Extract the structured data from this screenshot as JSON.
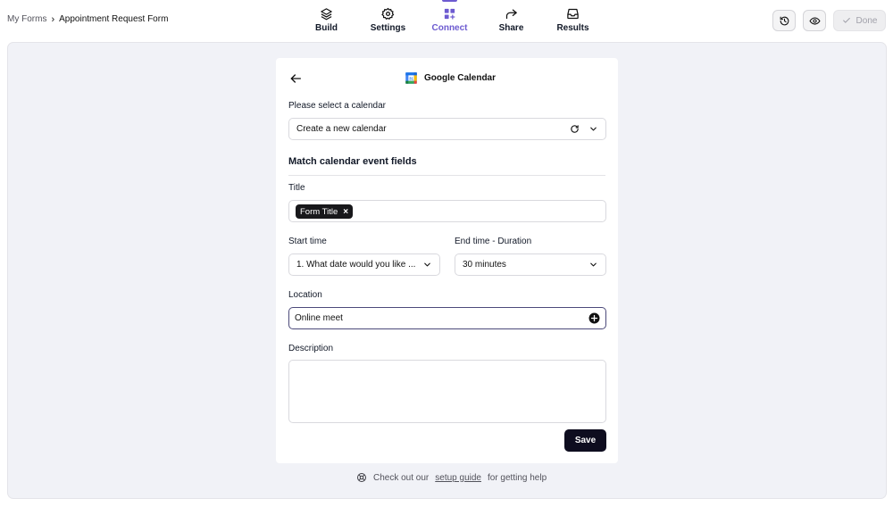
{
  "breadcrumb": {
    "parent": "My Forms",
    "separator": "›",
    "current": "Appointment Request Form"
  },
  "nav_tabs": [
    {
      "label": "Build",
      "icon": "layers-icon",
      "active": false
    },
    {
      "label": "Settings",
      "icon": "gear-icon",
      "active": false
    },
    {
      "label": "Connect",
      "icon": "grid-plus-icon",
      "active": true
    },
    {
      "label": "Share",
      "icon": "share-arrow-icon",
      "active": false
    },
    {
      "label": "Results",
      "icon": "inbox-icon",
      "active": false
    }
  ],
  "actions": {
    "history_icon": "history-icon",
    "preview_icon": "eye-icon",
    "done_label": "Done"
  },
  "colors": {
    "accent": "#6d5bd0",
    "primary_button": "#0e0d1f",
    "canvas_bg": "#f1f2f7"
  },
  "card": {
    "title": "Google Calendar",
    "calendar_label": "Please select a calendar",
    "calendar_value": "Create a new calendar",
    "section_title": "Match calendar event fields",
    "title_label": "Title",
    "title_chip": "Form Title",
    "title_chip_remove": "×",
    "start_label": "Start time",
    "start_value": "1. What date would you like ...",
    "end_label": "End time - Duration",
    "end_value": "30 minutes",
    "location_label": "Location",
    "location_value": "Online meet",
    "description_label": "Description",
    "description_value": "",
    "save_label": "Save"
  },
  "help": {
    "prefix": "Check out our",
    "link": "setup guide",
    "suffix": "for getting help"
  }
}
